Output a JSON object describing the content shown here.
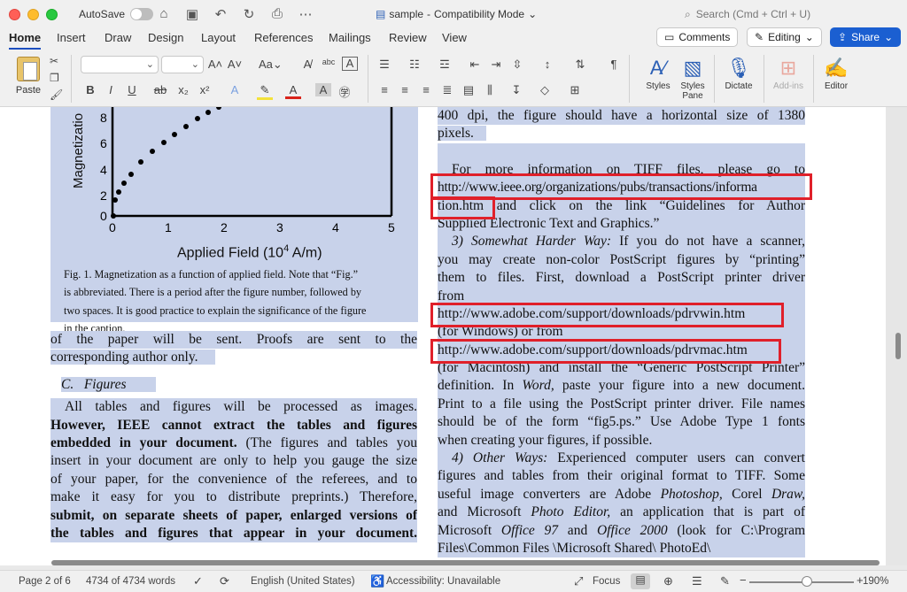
{
  "titlebar": {
    "autosave_label": "AutoSave",
    "doc_title": "sample",
    "doc_mode": "Compatibility Mode",
    "search_placeholder": "Search (Cmd + Ctrl + U)"
  },
  "tabs": [
    "Home",
    "Insert",
    "Draw",
    "Design",
    "Layout",
    "References",
    "Mailings",
    "Review",
    "View"
  ],
  "tab_buttons": {
    "comments": "Comments",
    "editing": "Editing",
    "share": "Share"
  },
  "ribbon": {
    "paste": "Paste",
    "styles": "Styles",
    "styles_pane": "Styles\nPane",
    "dictate": "Dictate",
    "addins": "Add-ins",
    "editor": "Editor"
  },
  "figure": {
    "ylabel": "Magnetizatio",
    "xlabel": "Applied Field (10",
    "xlabel_sup": "4",
    "xlabel_unit": " A/m)",
    "yticks": [
      "8",
      "6",
      "4",
      "2",
      "0"
    ],
    "xticks": [
      "0",
      "1",
      "2",
      "3",
      "4",
      "5"
    ],
    "caption": [
      "Fig. 1.  Magnetization as a function of applied field. Note that “Fig.”",
      "is abbreviated. There is a period after the figure number, followed by",
      "two spaces. It is good practice to explain the significance of the figure",
      "in the caption."
    ]
  },
  "left_column": {
    "l1": "of the paper will be sent. Proofs are sent to the",
    "l2": "corresponding author only.",
    "heading_letter": "C.",
    "heading": "Figures",
    "p1": "All tables and figures will be processed as images.",
    "p2b": "However, IEEE cannot extract the tables and figures",
    "p3b": "embedded in your document.",
    "p3": " (The figures and tables you",
    "p4": "insert in your document are only to help you gauge the size",
    "p5": "of your paper, for the convenience of the referees, and to",
    "p6": "make it easy for you to distribute preprints.) Therefore,",
    "p7b": "submit, on separate sheets of paper, enlarged versions of",
    "p8b": "the tables and figures that appear in your document."
  },
  "right_column": {
    "r1": "400 dpi, the figure should have a horizontal size of 1380",
    "r2": "pixels.",
    "r3": "For more information on TIFF files, please go to",
    "r4": "http://www.ieee.org/organizations/pubs/transactions/informa",
    "r5a": "tion.htm",
    "r5b": " and click on the link “Guidelines for Author",
    "r6": "Supplied Electronic Text and Graphics.”",
    "r7i": "3) Somewhat Harder Way:",
    "r7": " If you do not have a scanner,",
    "r8": "you may create non-color PostScript figures by “printing”",
    "r9": "them to files. First, download a PostScript printer driver",
    "r10": "from",
    "r11": "http://www.adobe.com/support/downloads/pdrvwin.htm",
    "r12": "(for Windows) or from",
    "r13": "http://www.adobe.com/support/downloads/pdrvmac.htm",
    "r14": "(for Macintosh) and install the “Generic PostScript Printer”",
    "r15a": "definition. In ",
    "r15i": "Word,",
    "r15b": " paste your figure into a new document.",
    "r16": "Print to a file using the PostScript printer driver. File names",
    "r17": "should be of the form “fig5.ps.” Use Adobe Type 1 fonts",
    "r18": "when creating your figures, if possible.",
    "r19i": "4) Other Ways:",
    "r19": " Experienced computer users can convert",
    "r20": "figures and tables from their original format to TIFF. Some",
    "r21a": "useful image converters are Adobe ",
    "r21i": "Photoshop,",
    "r21b": " Corel ",
    "r21i2": "Draw,",
    "r22a": "and Microsoft ",
    "r22i": "Photo Editor,",
    "r22b": " an application that is part of",
    "r23a": "Microsoft ",
    "r23i": "Office 97",
    "r23b": " and ",
    "r23i2": "Office 2000",
    "r23c": " (look for C:\\Program",
    "r24": "Files\\Common   Files   \\Microsoft   Shared\\   PhotoEd\\"
  },
  "status": {
    "page": "Page 2 of 6",
    "words": "4734 of 4734 words",
    "language": "English (United States)",
    "accessibility": "Accessibility: Unavailable",
    "focus": "Focus",
    "zoom": "190%"
  },
  "colors": {
    "selection": "#c8d2ea",
    "accent": "#1b5fd1",
    "annotation": "#e0202a"
  }
}
